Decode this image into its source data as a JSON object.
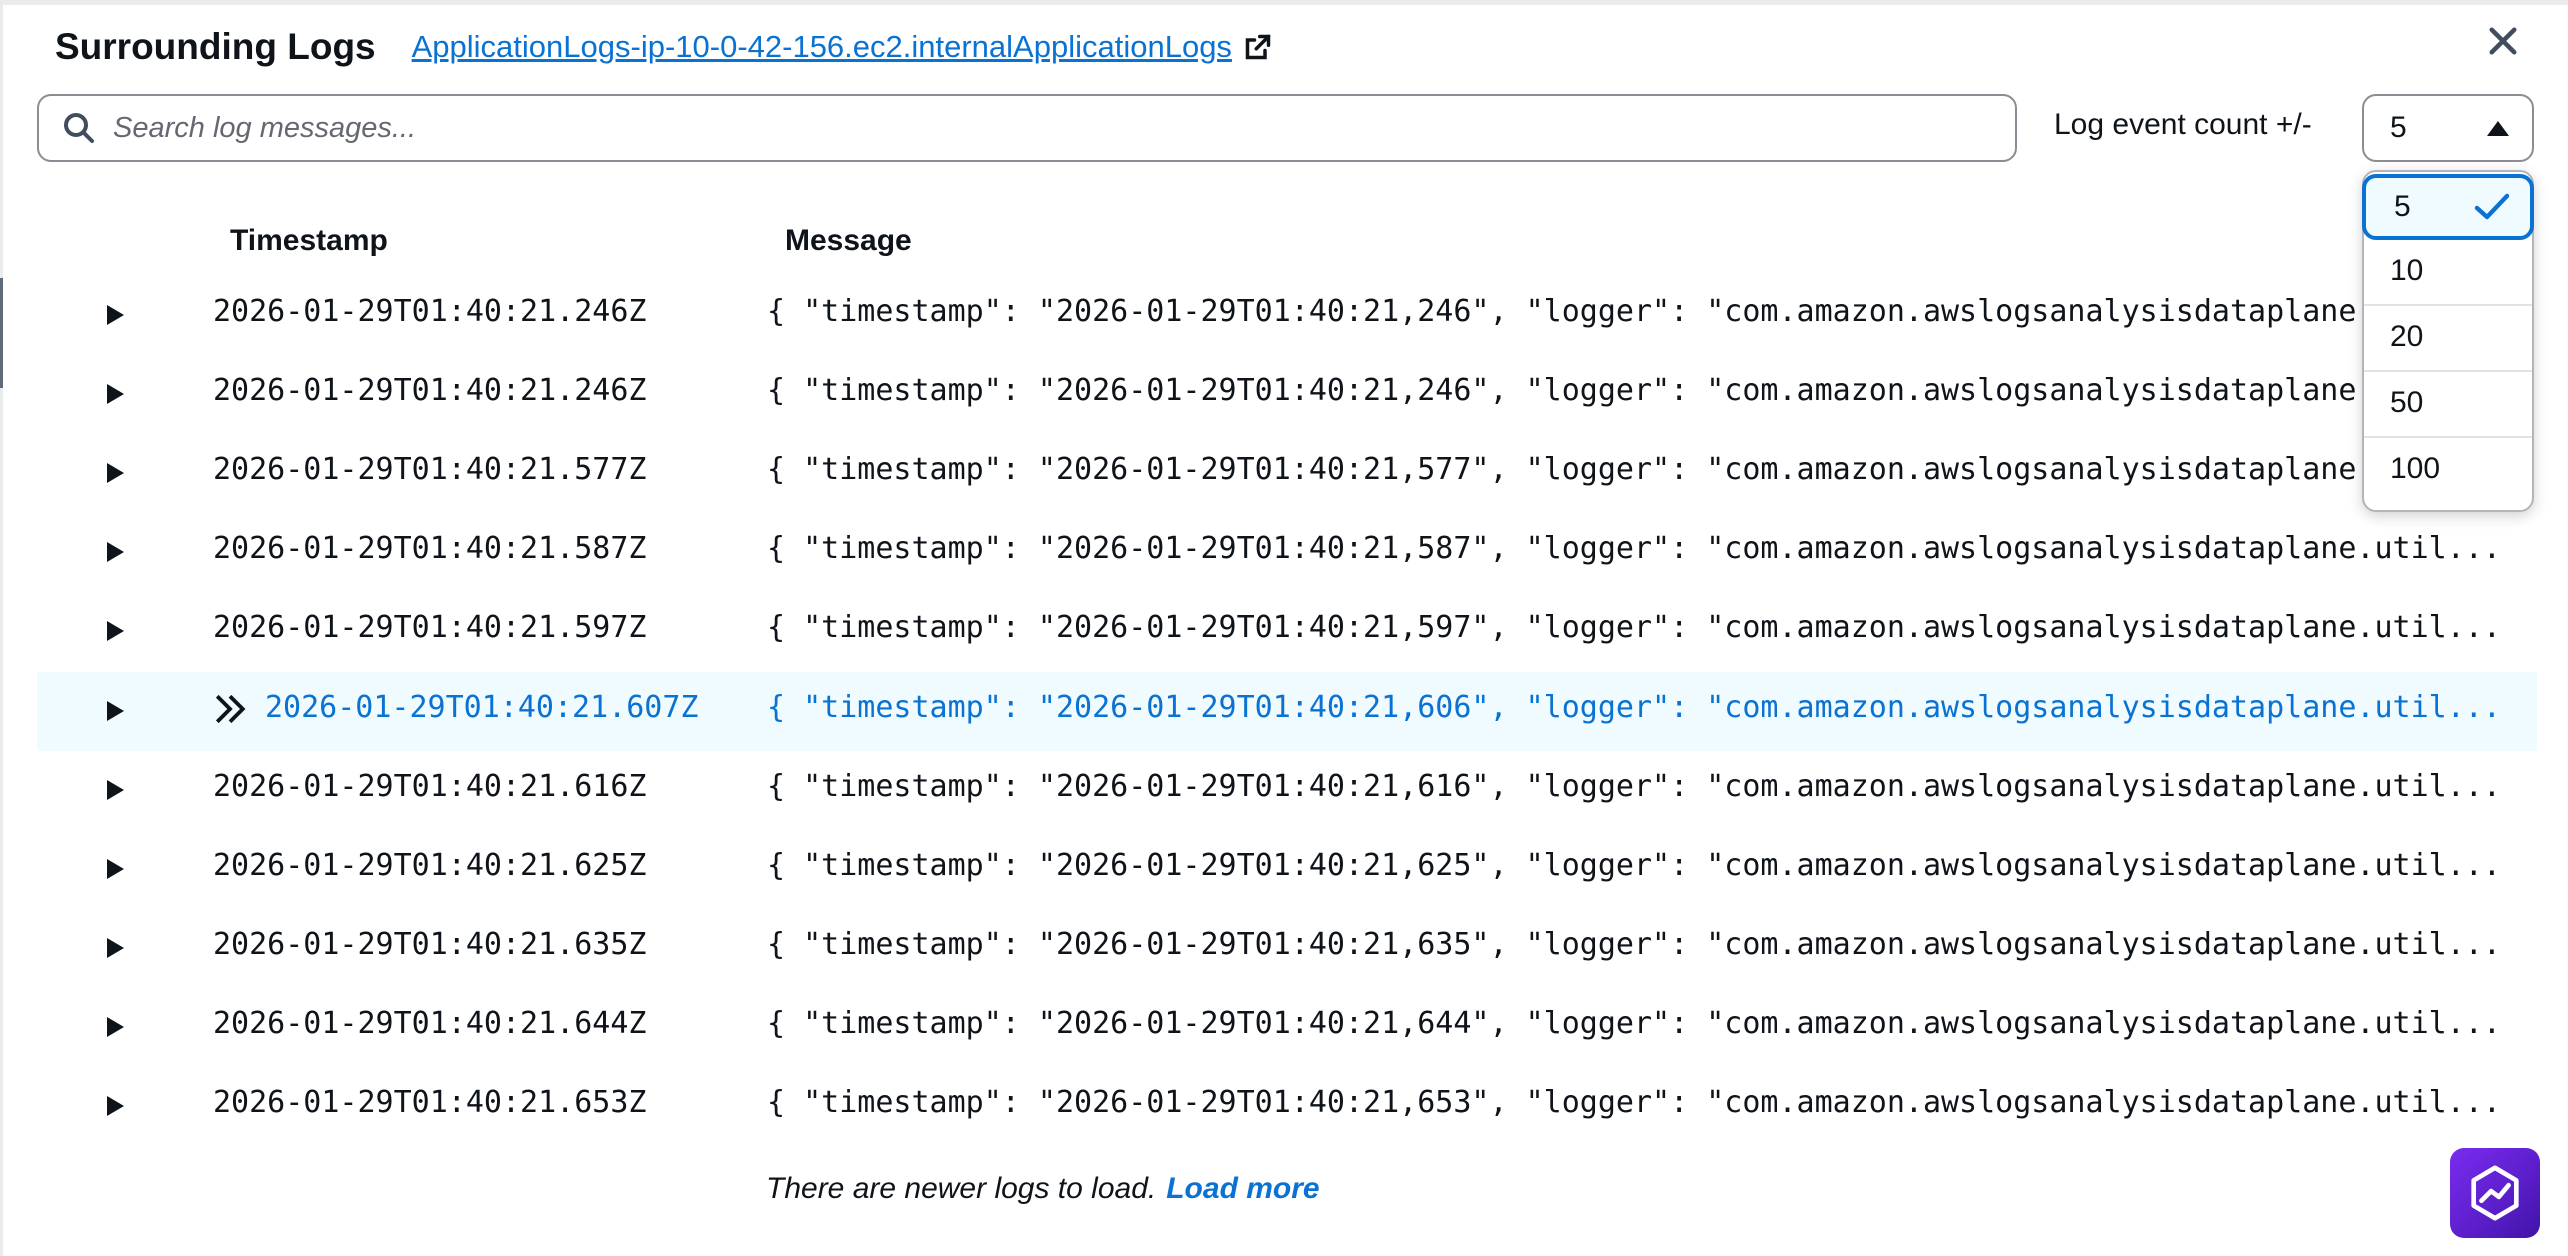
{
  "header": {
    "title": "Surrounding Logs",
    "log_group_link": "ApplicationLogs-ip-10-0-42-156.ec2.internalApplicationLogs"
  },
  "search": {
    "placeholder": "Search log messages...",
    "value": ""
  },
  "event_count": {
    "label": "Log event count +/-",
    "selected": "5",
    "options": [
      "5",
      "10",
      "20",
      "50",
      "100"
    ]
  },
  "table": {
    "columns": {
      "timestamp": "Timestamp",
      "message": "Message"
    },
    "rows": [
      {
        "timestamp": "2026-01-29T01:40:21.246Z",
        "message": "{ \"timestamp\": \"2026-01-29T01:40:21,246\", \"logger\": \"com.amazon.awslogsanalysisdataplane.util..."
      },
      {
        "timestamp": "2026-01-29T01:40:21.246Z",
        "message": "{ \"timestamp\": \"2026-01-29T01:40:21,246\", \"logger\": \"com.amazon.awslogsanalysisdataplane.util..."
      },
      {
        "timestamp": "2026-01-29T01:40:21.577Z",
        "message": "{ \"timestamp\": \"2026-01-29T01:40:21,577\", \"logger\": \"com.amazon.awslogsanalysisdataplane.util..."
      },
      {
        "timestamp": "2026-01-29T01:40:21.587Z",
        "message": "{ \"timestamp\": \"2026-01-29T01:40:21,587\", \"logger\": \"com.amazon.awslogsanalysisdataplane.util..."
      },
      {
        "timestamp": "2026-01-29T01:40:21.597Z",
        "message": "{ \"timestamp\": \"2026-01-29T01:40:21,597\", \"logger\": \"com.amazon.awslogsanalysisdataplane.util..."
      },
      {
        "timestamp": "2026-01-29T01:40:21.607Z",
        "message": "{ \"timestamp\": \"2026-01-29T01:40:21,606\", \"logger\": \"com.amazon.awslogsanalysisdataplane.util...",
        "current": true
      },
      {
        "timestamp": "2026-01-29T01:40:21.616Z",
        "message": "{ \"timestamp\": \"2026-01-29T01:40:21,616\", \"logger\": \"com.amazon.awslogsanalysisdataplane.util..."
      },
      {
        "timestamp": "2026-01-29T01:40:21.625Z",
        "message": "{ \"timestamp\": \"2026-01-29T01:40:21,625\", \"logger\": \"com.amazon.awslogsanalysisdataplane.util..."
      },
      {
        "timestamp": "2026-01-29T01:40:21.635Z",
        "message": "{ \"timestamp\": \"2026-01-29T01:40:21,635\", \"logger\": \"com.amazon.awslogsanalysisdataplane.util..."
      },
      {
        "timestamp": "2026-01-29T01:40:21.644Z",
        "message": "{ \"timestamp\": \"2026-01-29T01:40:21,644\", \"logger\": \"com.amazon.awslogsanalysisdataplane.util..."
      },
      {
        "timestamp": "2026-01-29T01:40:21.653Z",
        "message": "{ \"timestamp\": \"2026-01-29T01:40:21,653\", \"logger\": \"com.amazon.awslogsanalysisdataplane.util..."
      }
    ]
  },
  "footer": {
    "text": "There are newer logs to load.",
    "load_more": "Load more"
  },
  "icons": {
    "search": "search-icon",
    "external_link": "external-link-icon",
    "close": "close-icon",
    "caret_up": "caret-up-icon",
    "check": "check-icon",
    "expand": "caret-right-icon",
    "current_event": "double-chevron-right-icon",
    "assistant": "assistant-icon"
  },
  "colors": {
    "link": "#0972d3",
    "highlight_row": "#f0fbff",
    "text": "#0f141a",
    "border": "#8c8c94",
    "assistant": "#6b25e0"
  }
}
